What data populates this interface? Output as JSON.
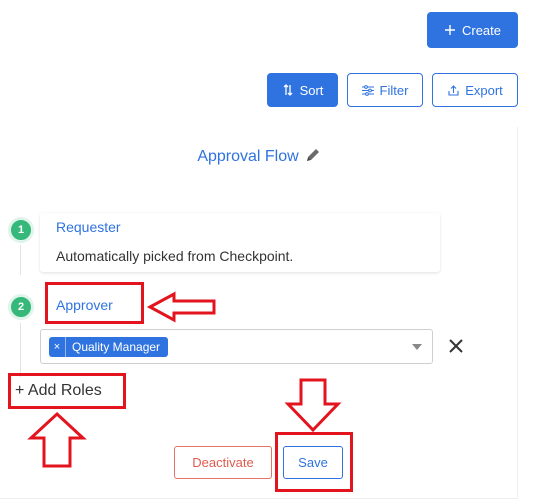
{
  "toolbar": {
    "create_label": "Create",
    "sort_label": "Sort",
    "filter_label": "Filter",
    "export_label": "Export"
  },
  "card": {
    "title": "Approval Flow",
    "steps": [
      {
        "number": "1",
        "title": "Requester",
        "description": "Automatically picked from Checkpoint."
      },
      {
        "number": "2",
        "title": "Approver",
        "selected_roles": [
          "Quality Manager"
        ]
      }
    ],
    "add_roles_label": "+ Add Roles",
    "deactivate_label": "Deactivate",
    "save_label": "Save"
  },
  "chip_remove_glyph": "×",
  "colors": {
    "primary": "#2f73e0",
    "step_green": "#35b87a",
    "danger": "#e05b4f",
    "annotation_red": "#e3141d"
  },
  "icons": {
    "create": "plus-icon",
    "sort": "sort-icon",
    "filter": "filter-icon",
    "export": "export-icon",
    "title_edit": "pencil-icon",
    "remove_role": "close-icon",
    "select_dropdown": "caret-down-icon"
  }
}
